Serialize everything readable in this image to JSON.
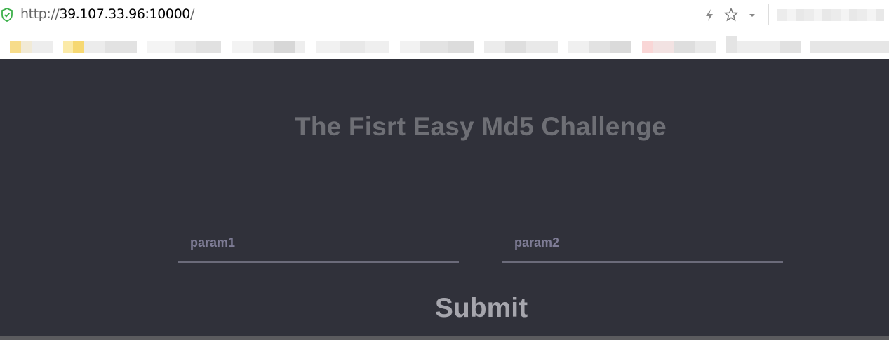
{
  "browser": {
    "url_scheme": "http://",
    "url_host": "39.107.33.96:10000",
    "url_trailing": "/",
    "icons": [
      "shield-check-icon",
      "lightning-icon",
      "star-icon",
      "chevron-down-icon"
    ]
  },
  "page": {
    "title": "The Fisrt Easy Md5 Challenge",
    "param1_placeholder": "param1",
    "param2_placeholder": "param2",
    "submit_label": "Submit"
  },
  "colors": {
    "page_background": "#30313a",
    "title": "#6e6f75",
    "placeholder": "#7e7c95",
    "underline": "#6b6b7a",
    "submit": "#a6a6ad"
  }
}
